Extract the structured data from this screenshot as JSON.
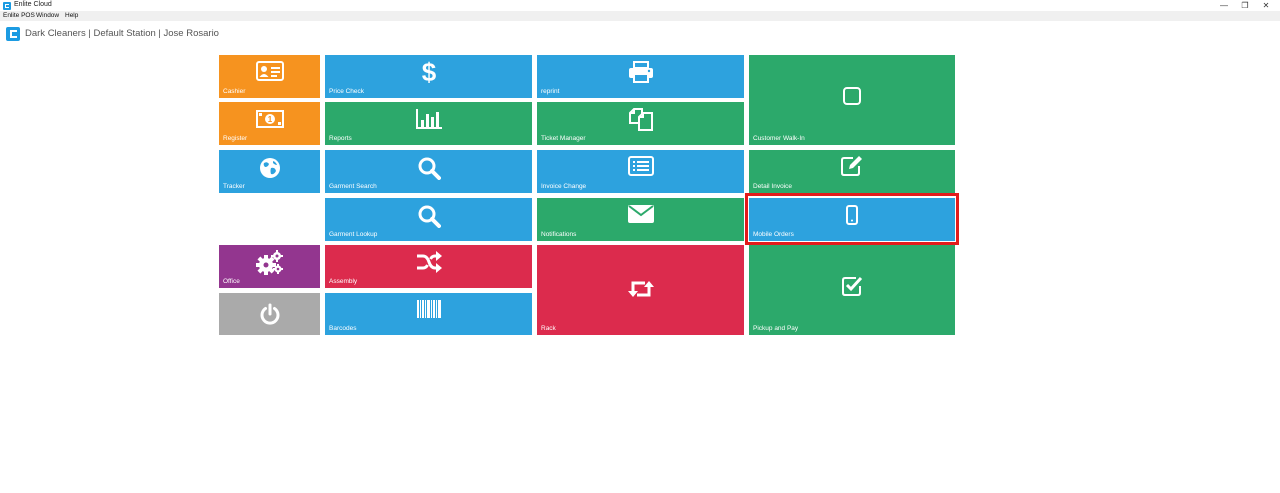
{
  "window": {
    "title": "Enlite Cloud",
    "controls": {
      "minimize": "—",
      "restore": "❐",
      "close": "✕"
    }
  },
  "menu": {
    "items": [
      "Enlite POS",
      "Window",
      "Help"
    ]
  },
  "header": {
    "text": "Dark Cleaners | Default Station | Jose Rosario"
  },
  "tiles": {
    "cashier": {
      "label": "Cashier",
      "icon": "id-card-icon"
    },
    "register": {
      "label": "Register",
      "icon": "money-bill-icon"
    },
    "tracker": {
      "label": "Tracker",
      "icon": "globe-icon"
    },
    "office": {
      "label": "Office",
      "icon": "gears-icon"
    },
    "power": {
      "label": "",
      "icon": "power-icon"
    },
    "price_check": {
      "label": "Price Check",
      "icon": "dollar-icon"
    },
    "reports": {
      "label": "Reports",
      "icon": "bar-chart-icon"
    },
    "garment_search": {
      "label": "Garment Search",
      "icon": "search-icon"
    },
    "garment_lookup": {
      "label": "Garment Lookup",
      "icon": "search-icon"
    },
    "assembly": {
      "label": "Assembly",
      "icon": "shuffle-icon"
    },
    "barcodes": {
      "label": "Barcodes",
      "icon": "barcode-icon"
    },
    "reprint": {
      "label": "reprint",
      "icon": "printer-icon"
    },
    "ticket_manager": {
      "label": "Ticket Manager",
      "icon": "copy-icon"
    },
    "invoice_change": {
      "label": "Invoice Change",
      "icon": "list-alt-icon"
    },
    "notifications": {
      "label": "Notifications",
      "icon": "envelope-icon"
    },
    "rack": {
      "label": "Rack",
      "icon": "retweet-icon"
    },
    "customer_walk_in": {
      "label": "Customer Walk-In",
      "icon": "square-icon"
    },
    "detail_invoice": {
      "label": "Detail Invoice",
      "icon": "edit-icon"
    },
    "mobile_orders": {
      "label": "Mobile Orders",
      "icon": "mobile-phone-icon"
    },
    "pickup_and_pay": {
      "label": "Pickup and Pay",
      "icon": "check-square-icon"
    }
  },
  "colors": {
    "orange": "#f6931f",
    "blue": "#2da2de",
    "green": "#2ca96b",
    "purple": "#93368f",
    "gray": "#aaaaaa",
    "red": "#dc2b4d",
    "highlight": "#e21b1b",
    "brand": "#1c9be2"
  }
}
